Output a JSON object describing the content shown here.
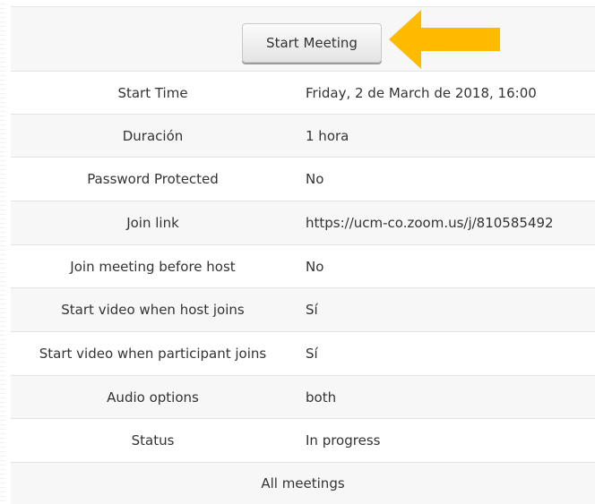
{
  "header": {
    "start_meeting_label": "Start Meeting"
  },
  "details": [
    {
      "label": "Start Time",
      "value": "Friday, 2 de March de 2018, 16:00"
    },
    {
      "label": "Duración",
      "value": "1 hora"
    },
    {
      "label": "Password Protected",
      "value": "No"
    },
    {
      "label": "Join link",
      "value": "https://ucm-co.zoom.us/j/810585492"
    },
    {
      "label": "Join meeting before host",
      "value": "No"
    },
    {
      "label": "Start video when host joins",
      "value": "Sí"
    },
    {
      "label": "Start video when participant joins",
      "value": "Sí"
    },
    {
      "label": "Audio options",
      "value": "both"
    },
    {
      "label": "Status",
      "value": "In progress"
    }
  ],
  "footer": {
    "all_meetings_label": "All meetings"
  },
  "annotation": {
    "arrow_icon": "arrow-left-icon",
    "arrow_color": "#FFBB00"
  },
  "colors": {
    "row_shade": "#F7F7F7",
    "border": "#E3E3E3",
    "text": "#333333"
  }
}
